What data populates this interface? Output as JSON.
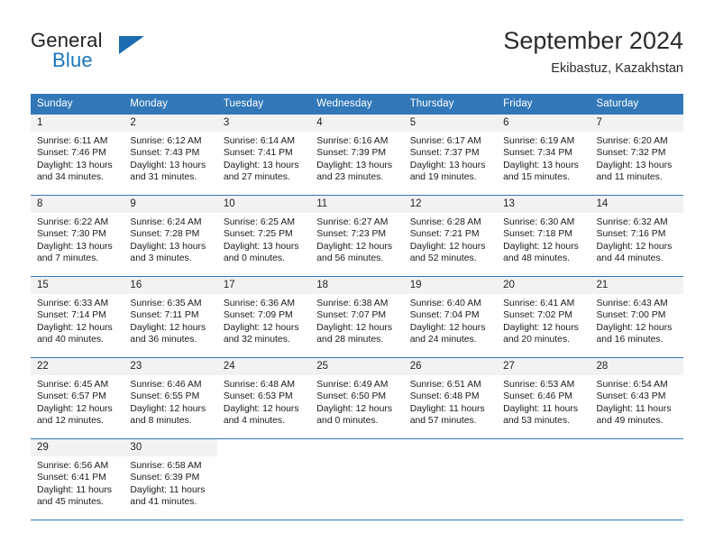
{
  "brand": {
    "name_top": "General",
    "name_bottom": "Blue",
    "triangle_color": "#1b6cb0",
    "blue_color": "#1b75bc"
  },
  "header": {
    "title": "September 2024",
    "subtitle": "Ekibastuz, Kazakhstan"
  },
  "theme": {
    "header_bg": "#3278b8",
    "daynum_bg": "#f2f2f2",
    "grid_line": "#3278b8"
  },
  "calendar": {
    "weekday_headers": [
      "Sunday",
      "Monday",
      "Tuesday",
      "Wednesday",
      "Thursday",
      "Friday",
      "Saturday"
    ],
    "weeks": [
      [
        {
          "day": "1",
          "sunrise": "Sunrise: 6:11 AM",
          "sunset": "Sunset: 7:46 PM",
          "daylight_1": "Daylight: 13 hours",
          "daylight_2": "and 34 minutes."
        },
        {
          "day": "2",
          "sunrise": "Sunrise: 6:12 AM",
          "sunset": "Sunset: 7:43 PM",
          "daylight_1": "Daylight: 13 hours",
          "daylight_2": "and 31 minutes."
        },
        {
          "day": "3",
          "sunrise": "Sunrise: 6:14 AM",
          "sunset": "Sunset: 7:41 PM",
          "daylight_1": "Daylight: 13 hours",
          "daylight_2": "and 27 minutes."
        },
        {
          "day": "4",
          "sunrise": "Sunrise: 6:16 AM",
          "sunset": "Sunset: 7:39 PM",
          "daylight_1": "Daylight: 13 hours",
          "daylight_2": "and 23 minutes."
        },
        {
          "day": "5",
          "sunrise": "Sunrise: 6:17 AM",
          "sunset": "Sunset: 7:37 PM",
          "daylight_1": "Daylight: 13 hours",
          "daylight_2": "and 19 minutes."
        },
        {
          "day": "6",
          "sunrise": "Sunrise: 6:19 AM",
          "sunset": "Sunset: 7:34 PM",
          "daylight_1": "Daylight: 13 hours",
          "daylight_2": "and 15 minutes."
        },
        {
          "day": "7",
          "sunrise": "Sunrise: 6:20 AM",
          "sunset": "Sunset: 7:32 PM",
          "daylight_1": "Daylight: 13 hours",
          "daylight_2": "and 11 minutes."
        }
      ],
      [
        {
          "day": "8",
          "sunrise": "Sunrise: 6:22 AM",
          "sunset": "Sunset: 7:30 PM",
          "daylight_1": "Daylight: 13 hours",
          "daylight_2": "and 7 minutes."
        },
        {
          "day": "9",
          "sunrise": "Sunrise: 6:24 AM",
          "sunset": "Sunset: 7:28 PM",
          "daylight_1": "Daylight: 13 hours",
          "daylight_2": "and 3 minutes."
        },
        {
          "day": "10",
          "sunrise": "Sunrise: 6:25 AM",
          "sunset": "Sunset: 7:25 PM",
          "daylight_1": "Daylight: 13 hours",
          "daylight_2": "and 0 minutes."
        },
        {
          "day": "11",
          "sunrise": "Sunrise: 6:27 AM",
          "sunset": "Sunset: 7:23 PM",
          "daylight_1": "Daylight: 12 hours",
          "daylight_2": "and 56 minutes."
        },
        {
          "day": "12",
          "sunrise": "Sunrise: 6:28 AM",
          "sunset": "Sunset: 7:21 PM",
          "daylight_1": "Daylight: 12 hours",
          "daylight_2": "and 52 minutes."
        },
        {
          "day": "13",
          "sunrise": "Sunrise: 6:30 AM",
          "sunset": "Sunset: 7:18 PM",
          "daylight_1": "Daylight: 12 hours",
          "daylight_2": "and 48 minutes."
        },
        {
          "day": "14",
          "sunrise": "Sunrise: 6:32 AM",
          "sunset": "Sunset: 7:16 PM",
          "daylight_1": "Daylight: 12 hours",
          "daylight_2": "and 44 minutes."
        }
      ],
      [
        {
          "day": "15",
          "sunrise": "Sunrise: 6:33 AM",
          "sunset": "Sunset: 7:14 PM",
          "daylight_1": "Daylight: 12 hours",
          "daylight_2": "and 40 minutes."
        },
        {
          "day": "16",
          "sunrise": "Sunrise: 6:35 AM",
          "sunset": "Sunset: 7:11 PM",
          "daylight_1": "Daylight: 12 hours",
          "daylight_2": "and 36 minutes."
        },
        {
          "day": "17",
          "sunrise": "Sunrise: 6:36 AM",
          "sunset": "Sunset: 7:09 PM",
          "daylight_1": "Daylight: 12 hours",
          "daylight_2": "and 32 minutes."
        },
        {
          "day": "18",
          "sunrise": "Sunrise: 6:38 AM",
          "sunset": "Sunset: 7:07 PM",
          "daylight_1": "Daylight: 12 hours",
          "daylight_2": "and 28 minutes."
        },
        {
          "day": "19",
          "sunrise": "Sunrise: 6:40 AM",
          "sunset": "Sunset: 7:04 PM",
          "daylight_1": "Daylight: 12 hours",
          "daylight_2": "and 24 minutes."
        },
        {
          "day": "20",
          "sunrise": "Sunrise: 6:41 AM",
          "sunset": "Sunset: 7:02 PM",
          "daylight_1": "Daylight: 12 hours",
          "daylight_2": "and 20 minutes."
        },
        {
          "day": "21",
          "sunrise": "Sunrise: 6:43 AM",
          "sunset": "Sunset: 7:00 PM",
          "daylight_1": "Daylight: 12 hours",
          "daylight_2": "and 16 minutes."
        }
      ],
      [
        {
          "day": "22",
          "sunrise": "Sunrise: 6:45 AM",
          "sunset": "Sunset: 6:57 PM",
          "daylight_1": "Daylight: 12 hours",
          "daylight_2": "and 12 minutes."
        },
        {
          "day": "23",
          "sunrise": "Sunrise: 6:46 AM",
          "sunset": "Sunset: 6:55 PM",
          "daylight_1": "Daylight: 12 hours",
          "daylight_2": "and 8 minutes."
        },
        {
          "day": "24",
          "sunrise": "Sunrise: 6:48 AM",
          "sunset": "Sunset: 6:53 PM",
          "daylight_1": "Daylight: 12 hours",
          "daylight_2": "and 4 minutes."
        },
        {
          "day": "25",
          "sunrise": "Sunrise: 6:49 AM",
          "sunset": "Sunset: 6:50 PM",
          "daylight_1": "Daylight: 12 hours",
          "daylight_2": "and 0 minutes."
        },
        {
          "day": "26",
          "sunrise": "Sunrise: 6:51 AM",
          "sunset": "Sunset: 6:48 PM",
          "daylight_1": "Daylight: 11 hours",
          "daylight_2": "and 57 minutes."
        },
        {
          "day": "27",
          "sunrise": "Sunrise: 6:53 AM",
          "sunset": "Sunset: 6:46 PM",
          "daylight_1": "Daylight: 11 hours",
          "daylight_2": "and 53 minutes."
        },
        {
          "day": "28",
          "sunrise": "Sunrise: 6:54 AM",
          "sunset": "Sunset: 6:43 PM",
          "daylight_1": "Daylight: 11 hours",
          "daylight_2": "and 49 minutes."
        }
      ],
      [
        {
          "day": "29",
          "sunrise": "Sunrise: 6:56 AM",
          "sunset": "Sunset: 6:41 PM",
          "daylight_1": "Daylight: 11 hours",
          "daylight_2": "and 45 minutes."
        },
        {
          "day": "30",
          "sunrise": "Sunrise: 6:58 AM",
          "sunset": "Sunset: 6:39 PM",
          "daylight_1": "Daylight: 11 hours",
          "daylight_2": "and 41 minutes."
        },
        {
          "day": "",
          "sunrise": "",
          "sunset": "",
          "daylight_1": "",
          "daylight_2": ""
        },
        {
          "day": "",
          "sunrise": "",
          "sunset": "",
          "daylight_1": "",
          "daylight_2": ""
        },
        {
          "day": "",
          "sunrise": "",
          "sunset": "",
          "daylight_1": "",
          "daylight_2": ""
        },
        {
          "day": "",
          "sunrise": "",
          "sunset": "",
          "daylight_1": "",
          "daylight_2": ""
        },
        {
          "day": "",
          "sunrise": "",
          "sunset": "",
          "daylight_1": "",
          "daylight_2": ""
        }
      ]
    ]
  }
}
